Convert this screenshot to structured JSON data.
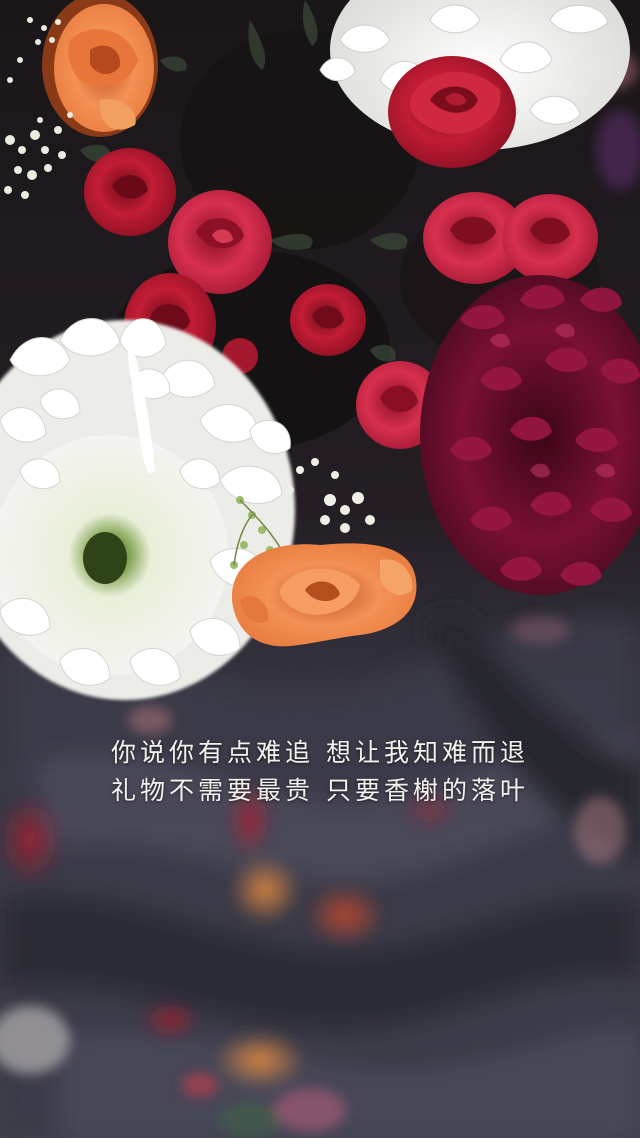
{
  "image": {
    "subject": "bouquet-of-flowers-on-dark-fabric",
    "colors": {
      "fabric": "#3d3d4d",
      "fabric_shadow": "#23232d",
      "chrysanthemum": "#f1f1ee",
      "chrysanthemum_center": "#7a9a4a",
      "rose_red": "#b3162c",
      "rose_dark": "#7a0d1d",
      "dahlia": "#6e0f2e",
      "rose_orange": "#f08a4b",
      "background_dark": "#1a1618"
    }
  },
  "caption": {
    "line1": "你说你有点难追 想让我知难而退",
    "line2": "礼物不需要最贵 只要香榭的落叶"
  }
}
